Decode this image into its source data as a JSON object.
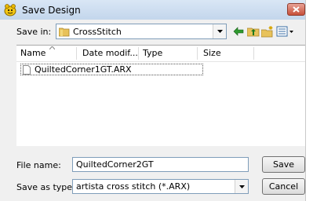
{
  "window": {
    "title": "Save Design"
  },
  "save_in": {
    "label": "Save in:",
    "value": "CrossStitch"
  },
  "toolbar": {
    "icons": [
      "back-arrow-icon",
      "up-folder-icon",
      "new-folder-icon",
      "view-menu-icon"
    ]
  },
  "file_list": {
    "columns": [
      "Name",
      "Date modif...",
      "Type",
      "Size"
    ],
    "items": [
      {
        "name": "QuiltedCorner1GT.ARX"
      }
    ]
  },
  "file_name": {
    "label": "File name:",
    "value": "QuiltedCorner2GT"
  },
  "save_as_type": {
    "label": "Save as type:",
    "value": "artista cross stitch (*.ARX)"
  },
  "buttons": {
    "save": "Save",
    "cancel": "Cancel"
  }
}
